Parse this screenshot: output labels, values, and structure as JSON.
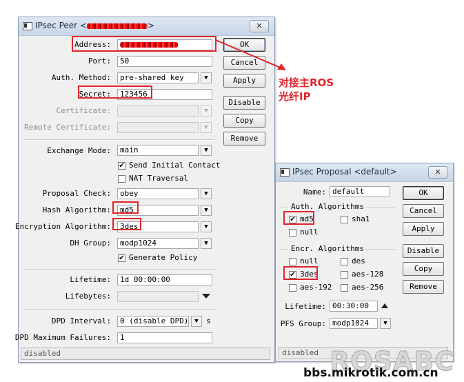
{
  "peer": {
    "title": "IPsec Peer <",
    "title_end": ">",
    "close": "✕",
    "labels": {
      "address": "Address:",
      "port": "Port:",
      "auth_method": "Auth. Method:",
      "secret": "Secret:",
      "certificate": "Certificate:",
      "remote_certificate": "Remote Certificate:",
      "exchange_mode": "Exchange Mode:",
      "proposal_check": "Proposal Check:",
      "hash_algorithm": "Hash Algorithm:",
      "encryption_algorithm": "Encryption Algorithm:",
      "dh_group": "DH Group:",
      "lifetime": "Lifetime:",
      "lifebytes": "Lifebytes:",
      "dpd_interval": "DPD Interval:",
      "dpd_max_failures": "DPD Maximum Failures:"
    },
    "values": {
      "port": "50",
      "auth_method": "pre-shared key",
      "secret": "123456",
      "exchange_mode": "main",
      "proposal_check": "obey",
      "hash_algorithm": "md5",
      "encryption_algorithm": "3des",
      "dh_group": "modp1024",
      "lifetime": "1d 00:00:00",
      "dpd_interval": "0 (disable DPD)",
      "dpd_interval_unit": "s",
      "dpd_max_failures": "1"
    },
    "checkboxes": {
      "send_initial_contact": {
        "label": "Send Initial Contact",
        "checked": true
      },
      "nat_traversal": {
        "label": "NAT Traversal",
        "checked": false
      },
      "generate_policy": {
        "label": "Generate Policy",
        "checked": true
      }
    },
    "buttons": {
      "ok": "OK",
      "cancel": "Cancel",
      "apply": "Apply",
      "disable": "Disable",
      "copy": "Copy",
      "remove": "Remove"
    },
    "status": "disabled"
  },
  "annotation": {
    "line1": "对接主ROS",
    "line2": "光纤IP",
    "color": "#e0262b"
  },
  "proposal": {
    "title": "IPsec Proposal <default>",
    "close": "✕",
    "name_label": "Name:",
    "name_value": "default",
    "auth_group": "Auth. Algorithms",
    "auth": {
      "md5": {
        "label": "md5",
        "checked": true
      },
      "sha1": {
        "label": "sha1",
        "checked": false
      },
      "null": {
        "label": "null",
        "checked": false
      }
    },
    "encr_group": "Encr. Algorithms",
    "encr": {
      "null": {
        "label": "null",
        "checked": false
      },
      "des": {
        "label": "des",
        "checked": false
      },
      "3des": {
        "label": "3des",
        "checked": true
      },
      "aes128": {
        "label": "aes-128",
        "checked": false
      },
      "aes192": {
        "label": "aes-192",
        "checked": false
      },
      "aes256": {
        "label": "aes-256",
        "checked": false
      }
    },
    "lifetime_label": "Lifetime:",
    "lifetime_value": "00:30:00",
    "pfs_label": "PFS Group:",
    "pfs_value": "modp1024",
    "buttons": {
      "ok": "OK",
      "cancel": "Cancel",
      "apply": "Apply",
      "disable": "Disable",
      "copy": "Copy",
      "remove": "Remove"
    },
    "status": "disabled"
  },
  "watermark": {
    "brand": "ROSABC",
    "site": "bbs.mikrotik.com.cn"
  },
  "icons": {
    "dropdown": "▼",
    "check": "✔"
  }
}
